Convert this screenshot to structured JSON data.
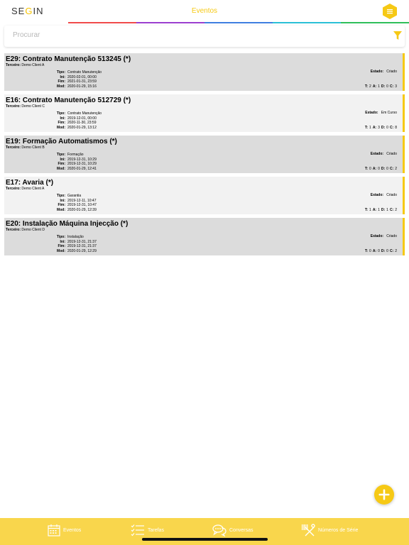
{
  "header": {
    "logo_text_1": "SE",
    "logo_text_g": "G",
    "logo_text_2": "IN",
    "title": "Eventos",
    "menu_icon": "hexagon-menu-icon",
    "accent_color": "#f6c915"
  },
  "search": {
    "placeholder": "Procurar",
    "value": "",
    "filter_icon": "filter-icon"
  },
  "labels": {
    "third_party": "Terceiro:",
    "type": "Tipo:",
    "start": "Ini:",
    "end": "Fim:",
    "modified": "Mod:",
    "state": "Estado:",
    "t": "T:",
    "a": "A:",
    "d": "D:",
    "c": "C:"
  },
  "events": [
    {
      "title": "E29: Contrato Manutenção 513245 (*)",
      "third_party": "Demo Client A",
      "type": "Contrato Manutenção",
      "start": "2020-02-01, 00:00",
      "end": "2021-01-31, 23:59",
      "modified": "2020-01-29, 15:16",
      "state": "Criado",
      "t": "2",
      "a": "1",
      "d": "0",
      "c": "3"
    },
    {
      "title": "E16: Contrato Manutenção 512729 (*)",
      "third_party": "Demo Client C",
      "type": "Contrato Manutenção",
      "start": "2019-12-01, 00:00",
      "end": "2020-11-30, 23:59",
      "modified": "2020-01-29, 13:12",
      "state": "Em Curso",
      "t": "1",
      "a": "3",
      "d": "0",
      "c": "8"
    },
    {
      "title": "E19: Formação Automatismos (*)",
      "third_party": "Demo Client B",
      "type": "Formação",
      "start": "2019-12-31, 10:29",
      "end": "2019-12-31, 10:29",
      "modified": "2020-01-29, 12:41",
      "state": "Criado",
      "t": "0",
      "a": "0",
      "d": "0",
      "c": "2"
    },
    {
      "title": "E17: Avaria (*)",
      "third_party": "Demo Client A",
      "type": "Garantia",
      "start": "2019-12-11, 10:47",
      "end": "2019-12-31, 10:47",
      "modified": "2020-01-29, 12:39",
      "state": "Criado",
      "t": "1",
      "a": "1",
      "d": "1",
      "c": "2"
    },
    {
      "title": "E20: Instalação Máquina Injecção (*)",
      "third_party": "Demo Client D",
      "type": "Instalação",
      "start": "2019-12-31, 21:37",
      "end": "2019-12-31, 21:37",
      "modified": "2020-01-29, 12:29",
      "state": "Criado",
      "t": "0",
      "a": "0",
      "d": "0",
      "c": "2"
    }
  ],
  "fab": {
    "icon": "plus-icon"
  },
  "tabs": [
    {
      "label": "Eventos",
      "icon": "calendar-icon"
    },
    {
      "label": "Tarefas",
      "icon": "checklist-icon"
    },
    {
      "label": "Conversas",
      "icon": "chat-bubbles-icon"
    },
    {
      "label": "Números de Série",
      "icon": "barcode-tools-icon"
    }
  ]
}
